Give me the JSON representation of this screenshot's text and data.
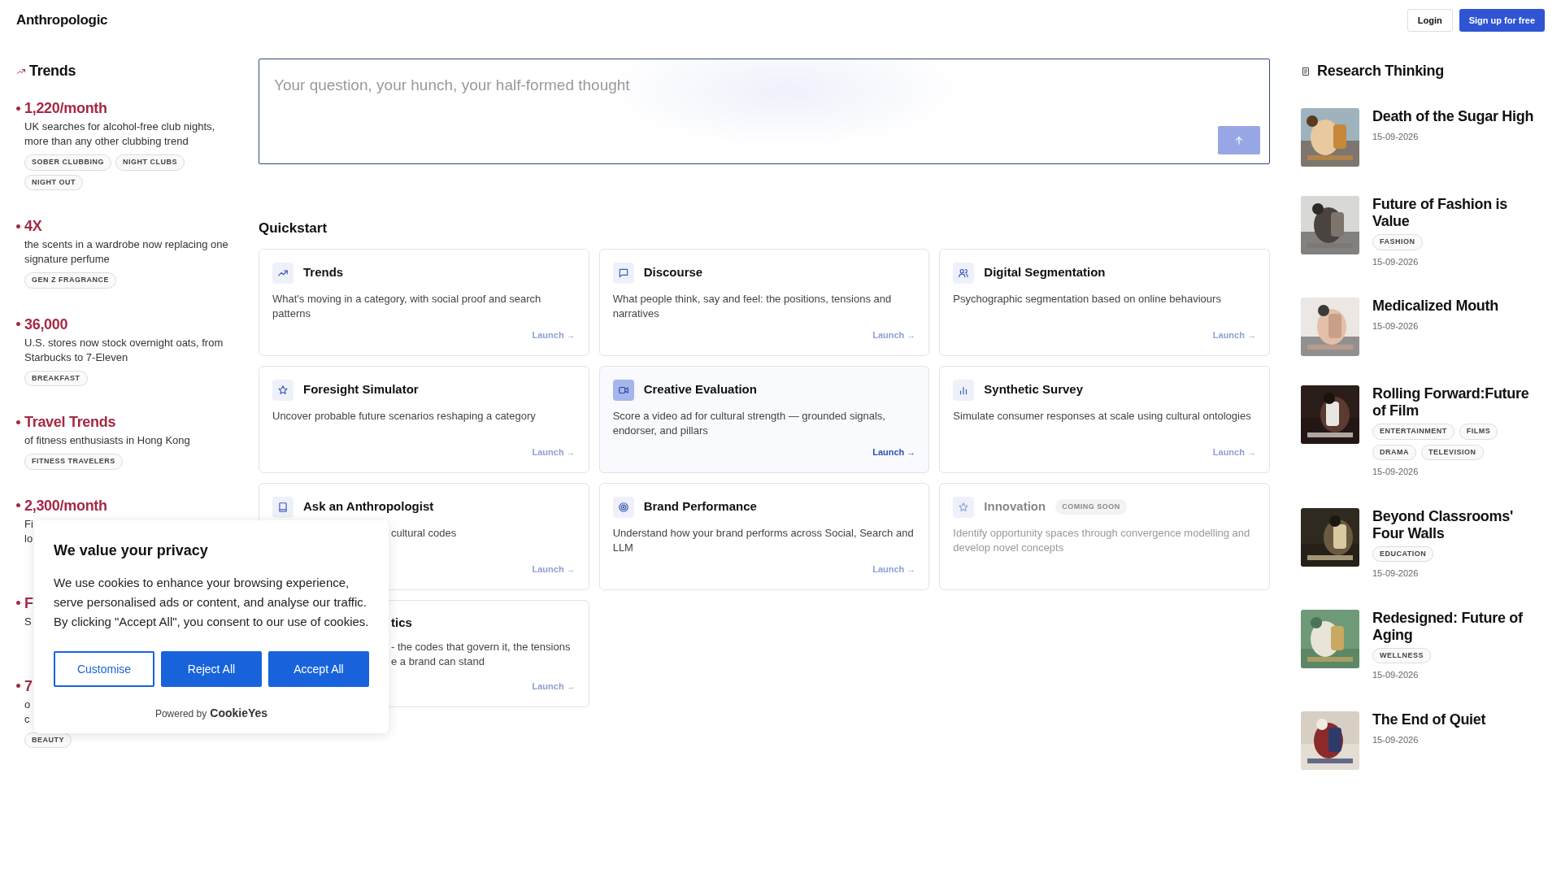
{
  "header": {
    "logo": "Anthropologic",
    "login": "Login",
    "signup": "Sign up for free"
  },
  "trends": {
    "title": "Trends",
    "items": [
      {
        "headline": "1,220/month",
        "description": "UK searches for alcohol-free club nights, more than any other clubbing trend",
        "tags": [
          "SOBER CLUBBING",
          "NIGHT CLUBS",
          "NIGHT OUT"
        ]
      },
      {
        "headline": "4X",
        "description": "the scents in a wardrobe now replacing one signature perfume",
        "tags": [
          "GEN Z FRAGRANCE"
        ]
      },
      {
        "headline": "36,000",
        "description": "U.S. stores now stock overnight oats, from Starbucks to 7-Eleven",
        "tags": [
          "BREAKFAST"
        ]
      },
      {
        "headline": "Travel Trends",
        "description": "of fitness enthusiasts in Hong Kong",
        "tags": [
          "FITNESS TRAVELERS"
        ]
      },
      {
        "headline": "2,300/month",
        "description": "Fi\nlo"
      },
      {
        "headline": "F",
        "description": "S"
      },
      {
        "headline": "7",
        "description": "o\nc",
        "tags": [
          "BEAUTY"
        ]
      }
    ]
  },
  "search": {
    "placeholder": "Your question, your hunch, your half-formed thought"
  },
  "quickstart": {
    "title": "Quickstart",
    "cards": [
      {
        "title": "Trends",
        "description": "What's moving in a category, with social proof and search patterns",
        "launch": "Launch →",
        "highlighted": false,
        "disabled": false,
        "covered": false
      },
      {
        "title": "Discourse",
        "description": "What people think, say and feel: the positions, tensions and narratives",
        "launch": "Launch →",
        "highlighted": false,
        "disabled": false,
        "covered": false
      },
      {
        "title": "Digital Segmentation",
        "description": "Psychographic segmentation based on online behaviours",
        "launch": "Launch →",
        "highlighted": false,
        "disabled": false,
        "covered": false
      },
      {
        "title": "Foresight Simulator",
        "description": "Uncover probable future scenarios reshaping a category",
        "launch": "Launch →",
        "highlighted": false,
        "disabled": false,
        "covered": false
      },
      {
        "title": "Creative Evaluation",
        "description": "Score a video ad for cultural strength — grounded signals, endorser, and pillars",
        "launch": "Launch →",
        "highlighted": true,
        "disabled": false,
        "covered": false
      },
      {
        "title": "Synthetic Survey",
        "description": "Simulate consumer responses at scale using cultural ontologies",
        "launch": "Launch →",
        "highlighted": false,
        "disabled": false,
        "covered": false
      },
      {
        "title": "Ask an Anthropologist",
        "description": "cultural codes",
        "launch": "Launch →",
        "highlighted": false,
        "disabled": false,
        "covered": true
      },
      {
        "title": "Brand Performance",
        "description": "Understand how your brand performs across Social, Search and LLM",
        "launch": "Launch →",
        "highlighted": false,
        "disabled": false,
        "covered": false
      },
      {
        "title": "Innovation",
        "badge": "COMING SOON",
        "description": "Identify opportunity spaces through convergence modelling and develop novel concepts",
        "highlighted": false,
        "disabled": true,
        "covered": false
      },
      {
        "title": "tics",
        "description": "- the codes that govern it, the tensions\ne a brand can stand",
        "launch": "Launch →",
        "highlighted": false,
        "disabled": false,
        "covered": true
      }
    ]
  },
  "research": {
    "title": "Research Thinking",
    "items": [
      {
        "kind": "picture",
        "title": "Death of the Sugar High",
        "date": "15-09-2026"
      },
      {
        "kind": "picture",
        "title": "Future of Fashion is Value",
        "tags": [
          "FASHION"
        ],
        "date": "15-09-2026"
      },
      {
        "kind": "picture",
        "title": "Medicalized Mouth",
        "date": "15-09-2026"
      },
      {
        "kind": "picture",
        "title": "Rolling Forward:Future of Film",
        "tags": [
          "ENTERTAINMENT",
          "FILMS",
          "DRAMA",
          "TELEVISION"
        ],
        "date": "15-09-2026"
      },
      {
        "kind": "picture",
        "title": "Beyond Classrooms' Four Walls",
        "tags": [
          "EDUCATION"
        ],
        "date": "15-09-2026"
      },
      {
        "kind": "picture",
        "title": "Redesigned: Future of Aging",
        "tags": [
          "WELLNESS"
        ],
        "date": "15-09-2026"
      },
      {
        "kind": "picture",
        "title": "The End of Quiet",
        "date": "15-09-2026"
      }
    ]
  },
  "cookie_banner": {
    "title": "We value your privacy",
    "text": "We use cookies to enhance your browsing experience, serve personalised ads or content, and analyse our traffic. By clicking \"Accept All\", you consent to our use of cookies.",
    "buttons": [
      "Customise",
      "Reject All",
      "Accept All"
    ],
    "powered_by": "Powered by",
    "brand": "CookieYes"
  }
}
